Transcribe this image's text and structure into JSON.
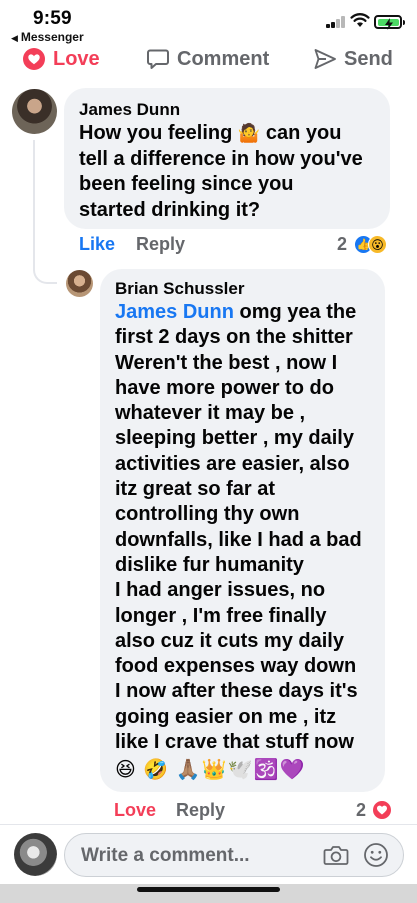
{
  "status_bar": {
    "time": "9:59",
    "back_app": "Messenger"
  },
  "action_bar": {
    "love_label": "Love",
    "comment_label": "Comment",
    "send_label": "Send"
  },
  "comments": [
    {
      "author": "James Dunn",
      "lines": [
        "How you feeling",
        "can you",
        "tell a difference in how you've",
        "been feeling since you",
        "started drinking it?"
      ],
      "inline_emoji": "🤷",
      "meta": {
        "like_label": "Like",
        "reply_label": "Reply",
        "reaction_count": "2"
      },
      "reactions": [
        "like",
        "wow"
      ]
    },
    {
      "author": "Brian Schussler",
      "mention": "James Dunn",
      "lines": [
        "omg yea the",
        "first 2 days on the shitter",
        "Weren't the best , now I",
        "have more power to do",
        "whatever it may be ,",
        "sleeping better , my daily",
        "activities are easier, also",
        "itz great so far at",
        "controlling thy own",
        "downfalls, like I had a bad",
        "dislike fur humanity",
        "I had anger issues, no",
        "longer , I'm free finally",
        "also cuz it cuts my daily",
        "food expenses way down",
        "I now after these days it's",
        "going easier on me , itz",
        "like I crave that stuff now"
      ],
      "emoji_line": "😆 🤣 🙏🏽👑🕊️🕉️💜",
      "meta": {
        "love_label": "Love",
        "reply_label": "Reply",
        "reaction_count": "2"
      },
      "reactions": [
        "love"
      ]
    }
  ],
  "composer": {
    "placeholder": "Write a comment..."
  },
  "colors": {
    "accent_blue": "#1877f2",
    "love_red": "#f33e58",
    "bubble_gray": "#f0f2f5",
    "meta_gray": "#65676b"
  }
}
